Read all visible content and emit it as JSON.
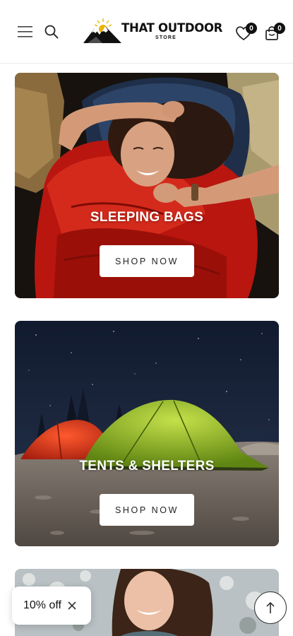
{
  "header": {
    "logo_title": "THAT OUTDOOR",
    "logo_subtitle": "STORE",
    "wishlist_count": "0",
    "cart_count": "0",
    "menu_icon": "hamburger-menu-icon",
    "search_icon": "search-icon",
    "wishlist_icon": "heart-icon",
    "cart_icon": "shopping-bag-icon"
  },
  "collections": [
    {
      "title": "SLEEPING BAGS",
      "button_label": "SHOP NOW"
    },
    {
      "title": "TENTS & SHELTERS",
      "button_label": "SHOP NOW"
    }
  ],
  "promo": {
    "label": "10% off",
    "close_icon": "close-icon"
  },
  "scroll_top": {
    "icon": "arrow-up-icon"
  },
  "colors": {
    "sleeping_bag_red": "#c81a16",
    "tent_green": "#7fa81c",
    "tent_red": "#d23a1c",
    "night_sky": "#18223a"
  }
}
